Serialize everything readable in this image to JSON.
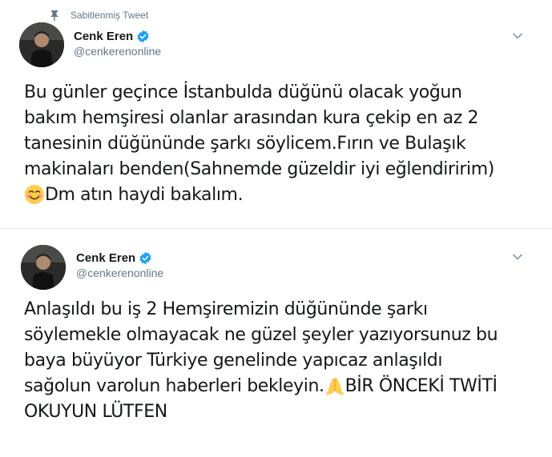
{
  "pinned_label": "Sabitlenmiş Tweet",
  "tweets": [
    {
      "display_name": "Cenk Eren",
      "handle": "@cenkerenonline",
      "lines": [
        "Bu günler geçince İstanbulda düğünü olacak yoğun",
        "bakım hemşiresi olanlar arasından kura çekip en az 2",
        "tanesinin düğününde şarkı söylicem.Fırın ve Bulaşık",
        "makinaları benden(Sahnemde güzeldir iyi eğlendiririm)"
      ],
      "last_line": "Dm atın haydi bakalım.",
      "emoji": "smiling-face-emoji"
    },
    {
      "display_name": "Cenk Eren",
      "handle": "@cenkerenonline",
      "lines": [
        "Anlaşıldı bu iş 2 Hemşiremizin düğününde şarkı",
        "söylemekle olmayacak ne güzel şeyler yazıyorsunuz bu",
        "baya büyüyor Türkiye genelinde yapıcaz anlaşıldı"
      ],
      "line4_before": "sağolun varolun haberleri bekleyin.",
      "line4_after": "BİR ÖNCEKİ TWİTİ",
      "last_line": "OKUYUN LÜTFEN",
      "emoji": "folded-hands-emoji"
    }
  ],
  "colors": {
    "text": "#14171a",
    "secondary": "#657786",
    "verified": "#1da1f2",
    "divider": "#e6ecf0"
  }
}
